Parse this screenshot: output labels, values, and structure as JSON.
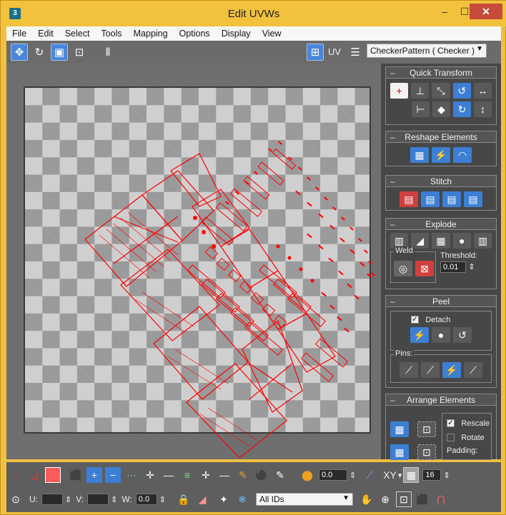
{
  "window": {
    "title": "Edit UVWs",
    "app_icon": "3"
  },
  "menu": [
    "File",
    "Edit",
    "Select",
    "Tools",
    "Mapping",
    "Options",
    "Display",
    "View"
  ],
  "toolbar": {
    "uv_label": "UV",
    "map_select": "CheckerPattern  ( Checker )"
  },
  "quick_transform": {
    "title": "Quick Transform"
  },
  "reshape": {
    "title": "Reshape Elements"
  },
  "stitch": {
    "title": "Stitch"
  },
  "explode": {
    "title": "Explode",
    "weld_label": "Weld",
    "threshold_label": "Threshold:",
    "threshold_value": "0.01"
  },
  "peel": {
    "title": "Peel",
    "detach_label": "Detach",
    "pins_label": "Pins:"
  },
  "arrange": {
    "title": "Arrange Elements",
    "rescale_label": "Rescale",
    "rotate_label": "Rotate",
    "padding_label": "Padding:"
  },
  "bottom": {
    "soft_value": "0.0",
    "xy_label": "XY",
    "zoom_value": "16",
    "u_label": "U:",
    "v_label": "V:",
    "w_label": "W:",
    "w_value": "0.0",
    "ids_select": "All IDs"
  },
  "colors": {
    "uv_wire": "#ff0000",
    "accent": "#3c7fd4",
    "titlebar": "#f3c23c"
  }
}
